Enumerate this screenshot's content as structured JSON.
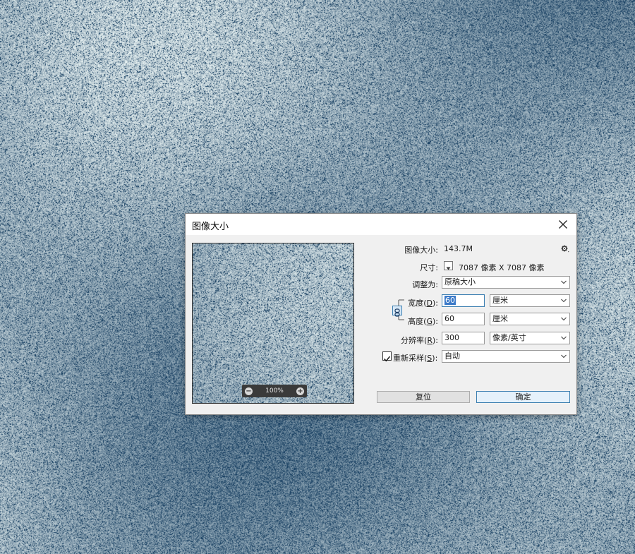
{
  "dialog": {
    "title": "图像大小",
    "close_icon": "close-icon"
  },
  "preview": {
    "zoom_label": "100%",
    "zoom_out_icon": "zoom-out-icon",
    "zoom_in_icon": "zoom-in-icon"
  },
  "info": {
    "image_size_label": "图像大小:",
    "image_size_value": "143.7M",
    "settings_icon": "gear-icon",
    "dimensions_label": "尺寸:",
    "dimensions_dropdown_icon": "triangle-down-icon",
    "dimensions_value": "7087 像素  X  7087 像素"
  },
  "fit_to": {
    "label": "调整为:",
    "value": "原稿大小"
  },
  "width": {
    "label_prefix": "宽度(",
    "label_key": "D",
    "label_suffix": "):",
    "value": "60",
    "unit": "厘米"
  },
  "height": {
    "label_prefix": "高度(",
    "label_key": "G",
    "label_suffix": "):",
    "value": "60",
    "unit": "厘米"
  },
  "constrain": {
    "icon": "link-icon",
    "enabled": true
  },
  "resolution": {
    "label_prefix": "分辨率(",
    "label_key": "R",
    "label_suffix": "):",
    "value": "300",
    "unit": "像素/英寸"
  },
  "resample": {
    "checked": true,
    "label_prefix": "重新采样(",
    "label_key": "S",
    "label_suffix": "):",
    "value": "自动"
  },
  "buttons": {
    "reset": "复位",
    "ok": "确定"
  },
  "colors": {
    "background_blue": "#6ea3c2",
    "dialog_bg": "#f0f0f0",
    "focus_blue": "#3c7fb1",
    "selection_blue": "#3a79c8"
  }
}
